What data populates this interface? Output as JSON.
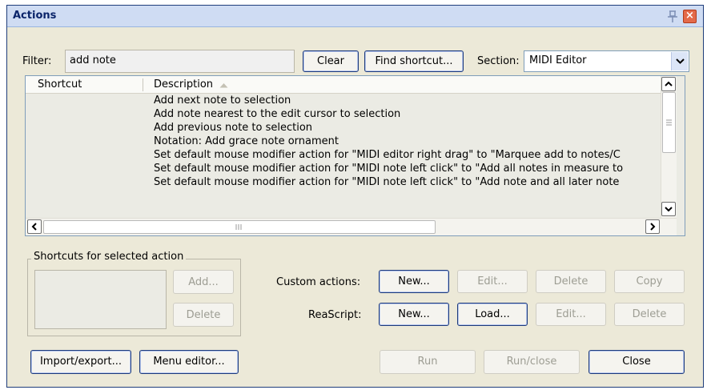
{
  "window": {
    "title": "Actions"
  },
  "filter": {
    "label": "Filter:",
    "value": "add note"
  },
  "buttons": {
    "clear": "Clear",
    "find_shortcut": "Find shortcut...",
    "add": "Add...",
    "delete": "Delete",
    "custom_new": "New...",
    "custom_edit": "Edit...",
    "custom_delete": "Delete",
    "custom_copy": "Copy",
    "reascript_new": "New...",
    "reascript_load": "Load...",
    "reascript_edit": "Edit...",
    "reascript_delete": "Delete",
    "import_export": "Import/export...",
    "menu_editor": "Menu editor...",
    "run": "Run",
    "run_close": "Run/close",
    "close": "Close"
  },
  "section": {
    "label": "Section:",
    "value": "MIDI Editor"
  },
  "list": {
    "columns": [
      "Shortcut",
      "Description"
    ],
    "rows": [
      {
        "shortcut": "",
        "description": "Add next note to selection"
      },
      {
        "shortcut": "",
        "description": "Add note nearest to the edit cursor to selection"
      },
      {
        "shortcut": "",
        "description": "Add previous note to selection"
      },
      {
        "shortcut": "",
        "description": "Notation: Add grace note ornament"
      },
      {
        "shortcut": "",
        "description": "Set default mouse modifier action for \"MIDI editor right drag\" to \"Marquee add to notes/C"
      },
      {
        "shortcut": "",
        "description": "Set default mouse modifier action for \"MIDI note left click\" to \"Add all notes in measure to"
      },
      {
        "shortcut": "",
        "description": "Set default mouse modifier action for \"MIDI note left click\" to \"Add note and all later note"
      }
    ]
  },
  "shortcuts_group": {
    "title": "Shortcuts for selected action"
  },
  "custom_actions": {
    "label": "Custom actions:"
  },
  "reascript": {
    "label": "ReaScript:"
  },
  "colors": {
    "title_text": "#0a246a",
    "close_button": "#e36a4a",
    "window_bg": "#ece9d8"
  },
  "icons": [
    "pin-icon",
    "close-icon",
    "sort-ascending-icon",
    "chevron-down-icon",
    "scroll-up-icon",
    "scroll-down-icon",
    "scroll-left-icon",
    "scroll-right-icon"
  ]
}
